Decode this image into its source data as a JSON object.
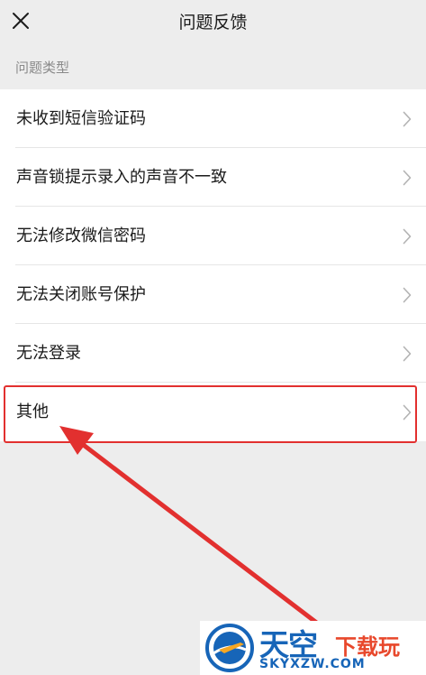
{
  "header": {
    "title": "问题反馈",
    "close_icon": "close-icon"
  },
  "section": {
    "label": "问题类型"
  },
  "list": {
    "items": [
      {
        "label": "未收到短信验证码"
      },
      {
        "label": "声音锁提示录入的声音不一致"
      },
      {
        "label": "无法修改微信密码"
      },
      {
        "label": "无法关闭账号保护"
      },
      {
        "label": "无法登录"
      },
      {
        "label": "其他"
      }
    ]
  },
  "annotation": {
    "highlight_color": "#e2302f",
    "highlighted_item": "其他"
  },
  "watermark": {
    "brand_big": "天空",
    "brand_small": "下载玩",
    "url": "SKYXZW.COM"
  },
  "colors": {
    "background": "#ededed",
    "list_background": "#ffffff",
    "text": "#1a1a1a",
    "secondary_text": "#8a8a8a",
    "chevron": "#b3b3b3"
  }
}
